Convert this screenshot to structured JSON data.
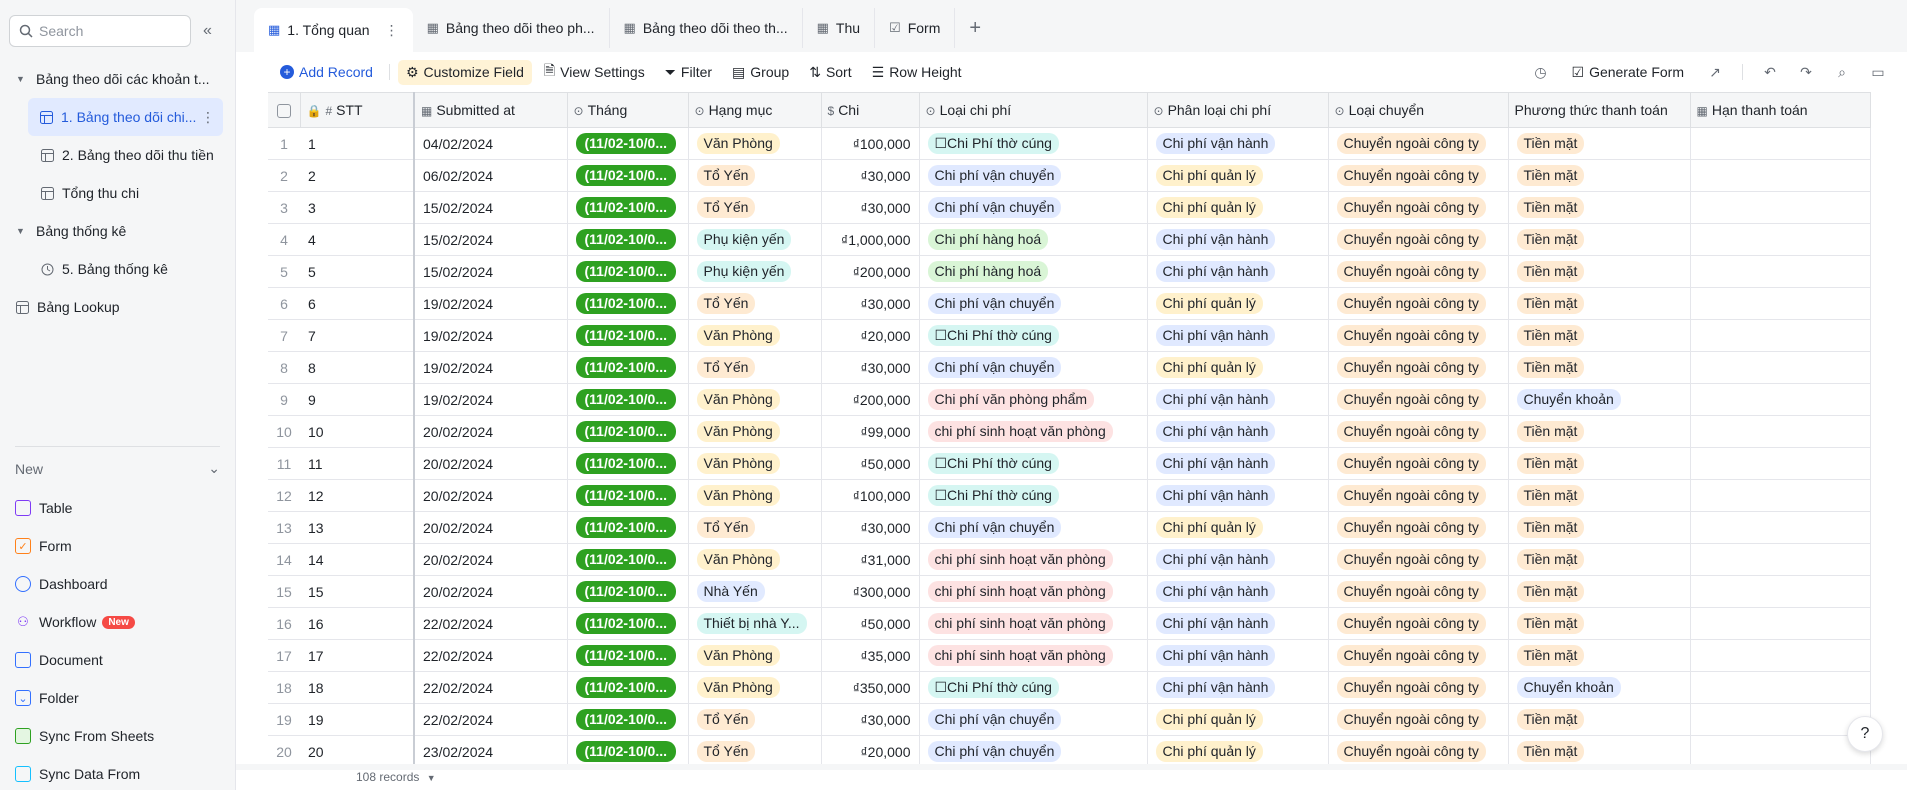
{
  "sidebar": {
    "search_placeholder": "Search",
    "tree": [
      {
        "label": "Bảng theo dõi các khoản t...",
        "type": "folder"
      },
      {
        "label": "1. Bảng theo dõi chi...",
        "type": "table",
        "active": true
      },
      {
        "label": "2. Bảng theo dõi thu tiền",
        "type": "table"
      },
      {
        "label": "Tổng thu chi",
        "type": "table"
      },
      {
        "label": "Bảng thống kê",
        "type": "folder"
      },
      {
        "label": "5. Bảng thống kê",
        "type": "dashboard"
      },
      {
        "label": "Bảng Lookup",
        "type": "table"
      }
    ],
    "new_label": "New",
    "new_items": [
      {
        "label": "Table",
        "icon": "table-icon",
        "color": "#7f3bf5"
      },
      {
        "label": "Form",
        "icon": "form-icon",
        "color": "#ff811a"
      },
      {
        "label": "Dashboard",
        "icon": "dashboard-icon",
        "color": "#3370ff"
      },
      {
        "label": "Workflow",
        "icon": "workflow-icon",
        "color": "#7f3bf5",
        "badge": "New"
      },
      {
        "label": "Document",
        "icon": "document-icon",
        "color": "#3370ff"
      },
      {
        "label": "Folder",
        "icon": "folder-icon",
        "color": "#3370ff"
      },
      {
        "label": "Sync From Sheets",
        "icon": "sheets-icon",
        "color": "#2ea121"
      },
      {
        "label": "Sync Data From",
        "icon": "sync-icon",
        "color": "#14c0ff"
      }
    ]
  },
  "tabs": [
    {
      "label": "1. Tổng quan",
      "active": true
    },
    {
      "label": "Bảng theo dõi theo ph..."
    },
    {
      "label": "Bảng theo dõi theo th..."
    },
    {
      "label": "Thu"
    },
    {
      "label": "Form"
    }
  ],
  "toolbar": {
    "add_record": "Add Record",
    "customize_field": "Customize Field",
    "view_settings": "View Settings",
    "filter": "Filter",
    "group": "Group",
    "sort": "Sort",
    "row_height": "Row Height",
    "generate_form": "Generate Form"
  },
  "columns": [
    "STT",
    "Submitted at",
    "Tháng",
    "Hạng mục",
    "Chi",
    "Loại chi phí",
    "Phân loại chi phí",
    "Loại chuyển",
    "Phương thức thanh toán",
    "Hạn thanh toán"
  ],
  "rows": [
    {
      "idx": "1",
      "stt": "1",
      "date": "04/02/2024",
      "thang": "(11/02-10/0...",
      "hang_muc": "Văn Phòng",
      "hm_color": "amber",
      "chi": "₫100,000",
      "loai": "☐Chi Phí thờ cúng",
      "loai_color": "cyan",
      "phan_loai": "Chi phí vận hành",
      "pl_color": "blue",
      "chuyen": "Chuyển ngoài công ty",
      "pt": "Tiền mặt",
      "pt_color": "orange"
    },
    {
      "idx": "2",
      "stt": "2",
      "date": "06/02/2024",
      "thang": "(11/02-10/0...",
      "hang_muc": "Tổ Yến",
      "hm_color": "orange",
      "chi": "₫30,000",
      "loai": "Chi phí vận chuyển",
      "loai_color": "blue",
      "phan_loai": "Chi phí quản lý",
      "pl_color": "amber",
      "chuyen": "Chuyển ngoài công ty",
      "pt": "Tiền mặt",
      "pt_color": "orange"
    },
    {
      "idx": "3",
      "stt": "3",
      "date": "15/02/2024",
      "thang": "(11/02-10/0...",
      "hang_muc": "Tổ Yến",
      "hm_color": "orange",
      "chi": "₫30,000",
      "loai": "Chi phí vận chuyển",
      "loai_color": "blue",
      "phan_loai": "Chi phí quản lý",
      "pl_color": "amber",
      "chuyen": "Chuyển ngoài công ty",
      "pt": "Tiền mặt",
      "pt_color": "orange"
    },
    {
      "idx": "4",
      "stt": "4",
      "date": "15/02/2024",
      "thang": "(11/02-10/0...",
      "hang_muc": "Phụ kiện yến",
      "hm_color": "cyan",
      "chi": "₫1,000,000",
      "loai": "Chi phí hàng hoá",
      "loai_color": "mint",
      "phan_loai": "Chi phí vận hành",
      "pl_color": "blue",
      "chuyen": "Chuyển ngoài công ty",
      "pt": "Tiền mặt",
      "pt_color": "orange"
    },
    {
      "idx": "5",
      "stt": "5",
      "date": "15/02/2024",
      "thang": "(11/02-10/0...",
      "hang_muc": "Phụ kiện yến",
      "hm_color": "cyan",
      "chi": "₫200,000",
      "loai": "Chi phí hàng hoá",
      "loai_color": "mint",
      "phan_loai": "Chi phí vận hành",
      "pl_color": "blue",
      "chuyen": "Chuyển ngoài công ty",
      "pt": "Tiền mặt",
      "pt_color": "orange"
    },
    {
      "idx": "6",
      "stt": "6",
      "date": "19/02/2024",
      "thang": "(11/02-10/0...",
      "hang_muc": "Tổ Yến",
      "hm_color": "orange",
      "chi": "₫30,000",
      "loai": "Chi phí vận chuyển",
      "loai_color": "blue",
      "phan_loai": "Chi phí quản lý",
      "pl_color": "amber",
      "chuyen": "Chuyển ngoài công ty",
      "pt": "Tiền mặt",
      "pt_color": "orange"
    },
    {
      "idx": "7",
      "stt": "7",
      "date": "19/02/2024",
      "thang": "(11/02-10/0...",
      "hang_muc": "Văn Phòng",
      "hm_color": "amber",
      "chi": "₫20,000",
      "loai": "☐Chi Phí thờ cúng",
      "loai_color": "cyan",
      "phan_loai": "Chi phí vận hành",
      "pl_color": "blue",
      "chuyen": "Chuyển ngoài công ty",
      "pt": "Tiền mặt",
      "pt_color": "orange"
    },
    {
      "idx": "8",
      "stt": "8",
      "date": "19/02/2024",
      "thang": "(11/02-10/0...",
      "hang_muc": "Tổ Yến",
      "hm_color": "orange",
      "chi": "₫30,000",
      "loai": "Chi phí vận chuyển",
      "loai_color": "blue",
      "phan_loai": "Chi phí quản lý",
      "pl_color": "amber",
      "chuyen": "Chuyển ngoài công ty",
      "pt": "Tiền mặt",
      "pt_color": "orange"
    },
    {
      "idx": "9",
      "stt": "9",
      "date": "19/02/2024",
      "thang": "(11/02-10/0...",
      "hang_muc": "Văn Phòng",
      "hm_color": "amber",
      "chi": "₫200,000",
      "loai": "Chi phí văn phòng phẩm",
      "loai_color": "pink",
      "phan_loai": "Chi phí vận hành",
      "pl_color": "blue",
      "chuyen": "Chuyển ngoài công ty",
      "pt": "Chuyển khoản",
      "pt_color": "lightblue"
    },
    {
      "idx": "10",
      "stt": "10",
      "date": "20/02/2024",
      "thang": "(11/02-10/0...",
      "hang_muc": "Văn Phòng",
      "hm_color": "amber",
      "chi": "₫99,000",
      "loai": "chi phí sinh hoạt văn phòng",
      "loai_color": "pink",
      "phan_loai": "Chi phí vận hành",
      "pl_color": "blue",
      "chuyen": "Chuyển ngoài công ty",
      "pt": "Tiền mặt",
      "pt_color": "orange"
    },
    {
      "idx": "11",
      "stt": "11",
      "date": "20/02/2024",
      "thang": "(11/02-10/0...",
      "hang_muc": "Văn Phòng",
      "hm_color": "amber",
      "chi": "₫50,000",
      "loai": "☐Chi Phí thờ cúng",
      "loai_color": "cyan",
      "phan_loai": "Chi phí vận hành",
      "pl_color": "blue",
      "chuyen": "Chuyển ngoài công ty",
      "pt": "Tiền mặt",
      "pt_color": "orange"
    },
    {
      "idx": "12",
      "stt": "12",
      "date": "20/02/2024",
      "thang": "(11/02-10/0...",
      "hang_muc": "Văn Phòng",
      "hm_color": "amber",
      "chi": "₫100,000",
      "loai": "☐Chi Phí thờ cúng",
      "loai_color": "cyan",
      "phan_loai": "Chi phí vận hành",
      "pl_color": "blue",
      "chuyen": "Chuyển ngoài công ty",
      "pt": "Tiền mặt",
      "pt_color": "orange"
    },
    {
      "idx": "13",
      "stt": "13",
      "date": "20/02/2024",
      "thang": "(11/02-10/0...",
      "hang_muc": "Tổ Yến",
      "hm_color": "orange",
      "chi": "₫30,000",
      "loai": "Chi phí vận chuyển",
      "loai_color": "blue",
      "phan_loai": "Chi phí quản lý",
      "pl_color": "amber",
      "chuyen": "Chuyển ngoài công ty",
      "pt": "Tiền mặt",
      "pt_color": "orange"
    },
    {
      "idx": "14",
      "stt": "14",
      "date": "20/02/2024",
      "thang": "(11/02-10/0...",
      "hang_muc": "Văn Phòng",
      "hm_color": "amber",
      "chi": "₫31,000",
      "loai": "chi phí sinh hoạt văn phòng",
      "loai_color": "pink",
      "phan_loai": "Chi phí vận hành",
      "pl_color": "blue",
      "chuyen": "Chuyển ngoài công ty",
      "pt": "Tiền mặt",
      "pt_color": "orange"
    },
    {
      "idx": "15",
      "stt": "15",
      "date": "20/02/2024",
      "thang": "(11/02-10/0...",
      "hang_muc": "Nhà Yến",
      "hm_color": "lightblue",
      "chi": "₫300,000",
      "loai": "chi phí sinh hoạt văn phòng",
      "loai_color": "pink",
      "phan_loai": "Chi phí vận hành",
      "pl_color": "blue",
      "chuyen": "Chuyển ngoài công ty",
      "pt": "Tiền mặt",
      "pt_color": "orange"
    },
    {
      "idx": "16",
      "stt": "16",
      "date": "22/02/2024",
      "thang": "(11/02-10/0...",
      "hang_muc": "Thiết bị nhà Y...",
      "hm_color": "cyan",
      "chi": "₫50,000",
      "loai": "chi phí sinh hoạt văn phòng",
      "loai_color": "pink",
      "phan_loai": "Chi phí vận hành",
      "pl_color": "blue",
      "chuyen": "Chuyển ngoài công ty",
      "pt": "Tiền mặt",
      "pt_color": "orange"
    },
    {
      "idx": "17",
      "stt": "17",
      "date": "22/02/2024",
      "thang": "(11/02-10/0...",
      "hang_muc": "Văn Phòng",
      "hm_color": "amber",
      "chi": "₫35,000",
      "loai": "chi phí sinh hoạt văn phòng",
      "loai_color": "pink",
      "phan_loai": "Chi phí vận hành",
      "pl_color": "blue",
      "chuyen": "Chuyển ngoài công ty",
      "pt": "Tiền mặt",
      "pt_color": "orange"
    },
    {
      "idx": "18",
      "stt": "18",
      "date": "22/02/2024",
      "thang": "(11/02-10/0...",
      "hang_muc": "Văn Phòng",
      "hm_color": "amber",
      "chi": "₫350,000",
      "loai": "☐Chi Phí thờ cúng",
      "loai_color": "cyan",
      "phan_loai": "Chi phí vận hành",
      "pl_color": "blue",
      "chuyen": "Chuyển ngoài công ty",
      "pt": "Chuyển khoản",
      "pt_color": "lightblue"
    },
    {
      "idx": "19",
      "stt": "19",
      "date": "22/02/2024",
      "thang": "(11/02-10/0...",
      "hang_muc": "Tổ Yến",
      "hm_color": "orange",
      "chi": "₫30,000",
      "loai": "Chi phí vận chuyển",
      "loai_color": "blue",
      "phan_loai": "Chi phí quản lý",
      "pl_color": "amber",
      "chuyen": "Chuyển ngoài công ty",
      "pt": "Tiền mặt",
      "pt_color": "orange"
    },
    {
      "idx": "20",
      "stt": "20",
      "date": "23/02/2024",
      "thang": "(11/02-10/0...",
      "hang_muc": "Tổ Yến",
      "hm_color": "orange",
      "chi": "₫20,000",
      "loai": "Chi phí vận chuyển",
      "loai_color": "blue",
      "phan_loai": "Chi phí quản lý",
      "pl_color": "amber",
      "chuyen": "Chuyển ngoài công ty",
      "pt": "Tiền mặt",
      "pt_color": "orange"
    }
  ],
  "footer": {
    "records": "108 records"
  },
  "colors": {
    "accent": "#245bdb",
    "month_pill": "#2ea121"
  }
}
